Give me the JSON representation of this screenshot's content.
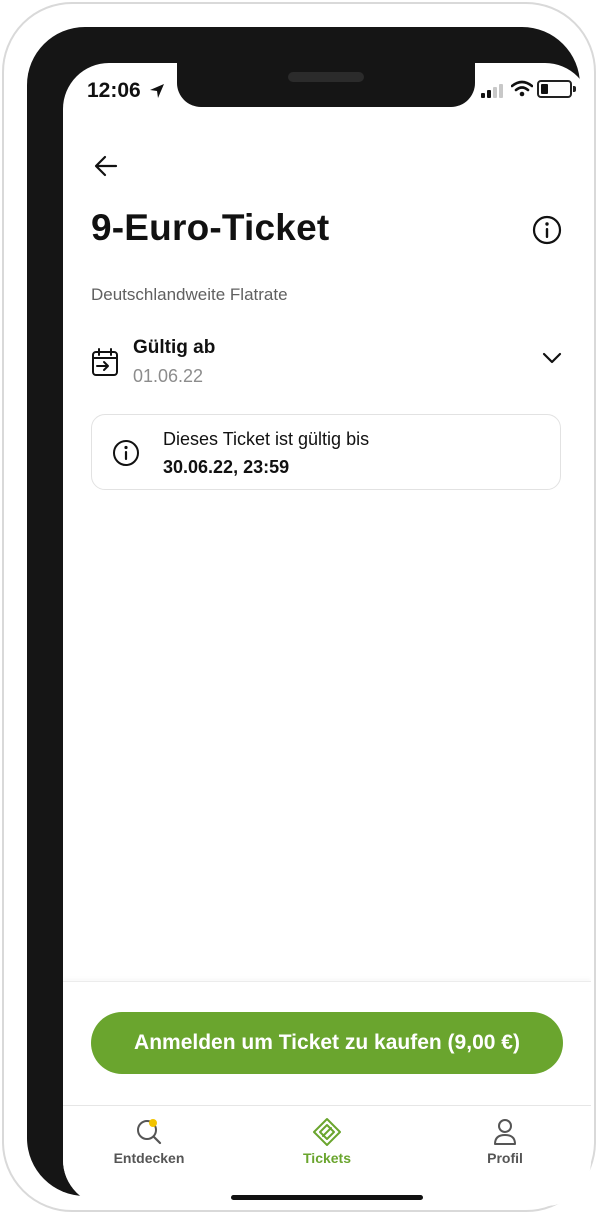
{
  "status_bar": {
    "time": "12:06"
  },
  "header": {
    "title": "9-Euro-Ticket",
    "subtitle": "Deutschlandweite Flatrate"
  },
  "validity": {
    "label": "Gültig ab",
    "date": "01.06.22"
  },
  "info_box": {
    "line1": "Dieses Ticket ist gültig bis",
    "line2": "30.06.22, 23:59"
  },
  "cta": {
    "label": "Anmelden um Ticket zu kaufen (9,00 €)"
  },
  "tabbar": {
    "items": [
      {
        "label": "Entdecken",
        "icon": "search-icon",
        "badge": true
      },
      {
        "label": "Tickets",
        "icon": "ticket-icon",
        "active": true
      },
      {
        "label": "Profil",
        "icon": "profile-icon"
      }
    ]
  },
  "colors": {
    "accent": "#6aa52e",
    "badge": "#f2c300",
    "text": "#111111",
    "muted": "#8c8c8c"
  }
}
